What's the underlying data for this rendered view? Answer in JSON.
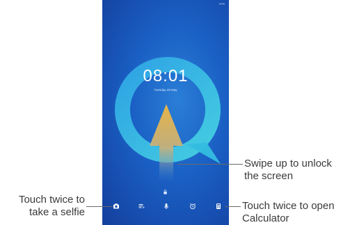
{
  "lockscreen": {
    "status_text": "97%",
    "time": "08:01",
    "date": "Tuesday 29 May"
  },
  "dock": {
    "icons": [
      "camera-icon",
      "notes-icon",
      "microphone-icon",
      "alarm-icon",
      "calculator-icon"
    ]
  },
  "callouts": {
    "swipe_line1": "Swipe up to unlock",
    "swipe_line2": "the screen",
    "selfie_line1": "Touch twice to",
    "selfie_line2": "take a selfie",
    "calc_line1": "Touch twice to open",
    "calc_line2": "Calculator"
  },
  "colors": {
    "wallpaper": "#1a5fc4",
    "ring": "#34b8e0",
    "arrow": "#e8b24a"
  }
}
